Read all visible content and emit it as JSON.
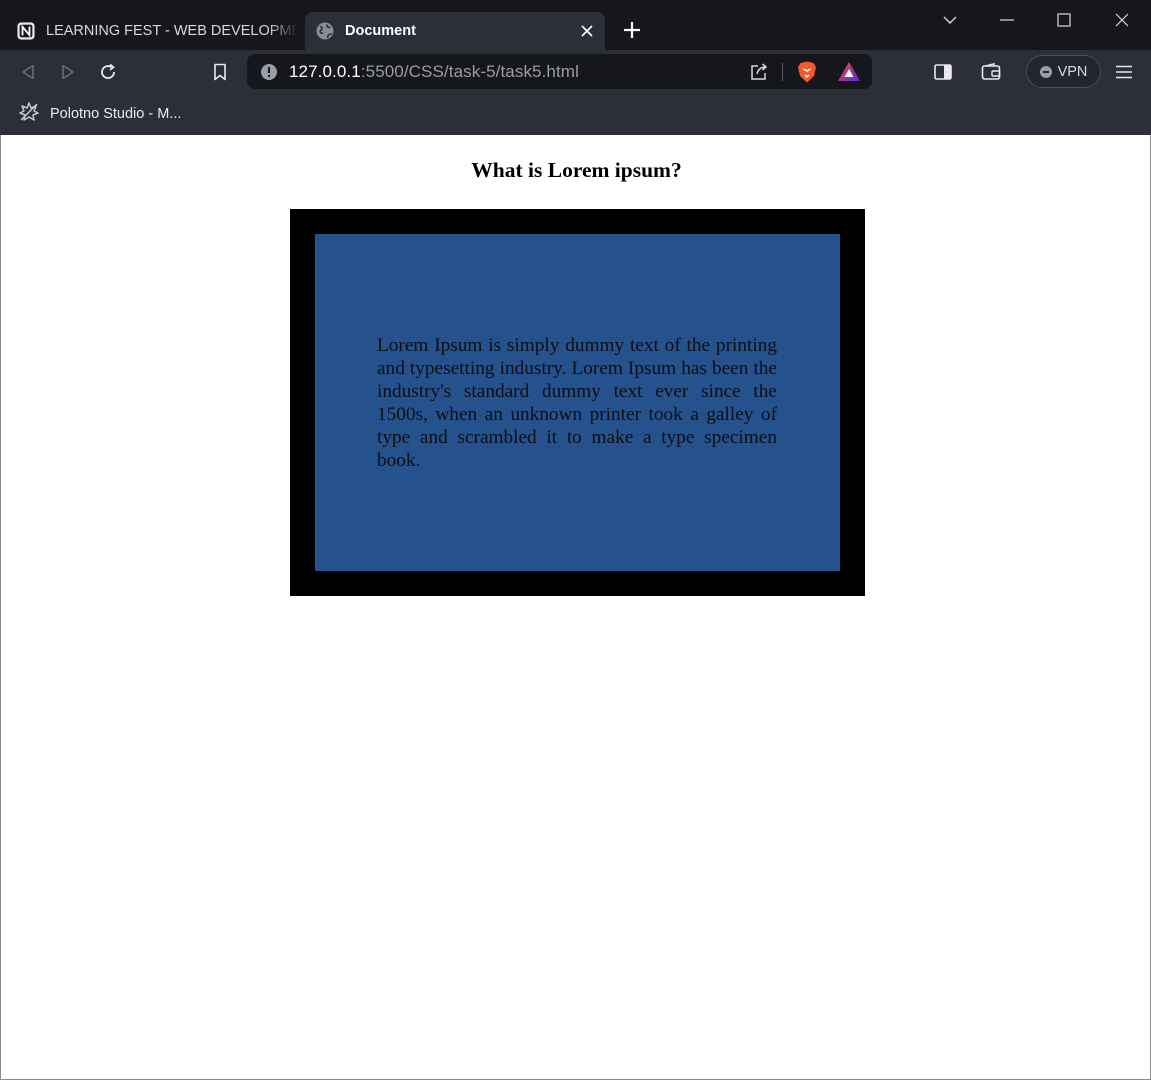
{
  "browser": {
    "tabs": [
      {
        "title": "LEARNING FEST - WEB DEVELOPMENT",
        "icon": "notion-icon",
        "active": false
      },
      {
        "title": "Document",
        "icon": "globe-icon",
        "active": true
      }
    ],
    "address": {
      "host": "127.0.0.1",
      "path": ":5500/CSS/task-5/task5.html"
    },
    "vpn_label": "VPN",
    "bookmarks": [
      {
        "label": "Polotno Studio - M...",
        "icon": "polotno-icon"
      }
    ]
  },
  "page": {
    "heading": "What is Lorem ipsum?",
    "paragraph": "Lorem Ipsum is simply dummy text of the printing and typesetting industry. Lorem Ipsum has been the industry's standard dummy text ever since the 1500s, when an unknown printer took a galley of type and scrambled it to make a type specimen book."
  },
  "colors": {
    "tab_strip": "#16171d",
    "toolbar": "#2c2e38",
    "outer_box": "#000000",
    "inner_box": "#25528d"
  }
}
